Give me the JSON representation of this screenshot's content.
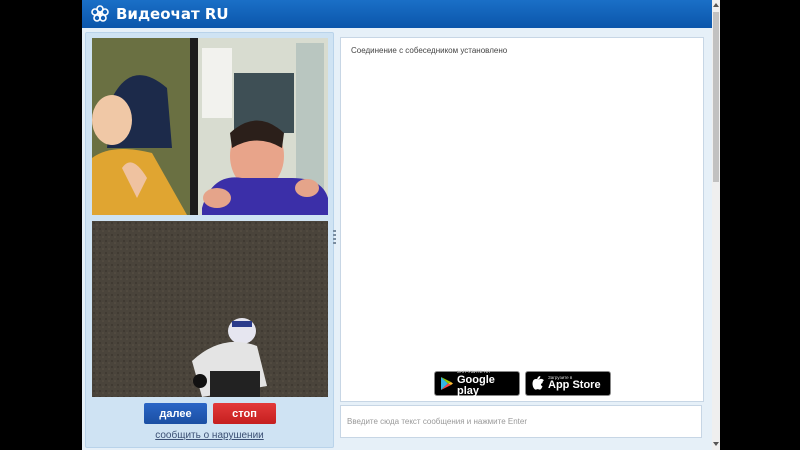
{
  "app": {
    "logo_icon": "flower-logo-icon",
    "title": "Видеочат RU",
    "brand_color": "#0b56ab"
  },
  "video": {
    "partner_icon": "partner-webcam-feed",
    "self_icon": "self-webcam-feed"
  },
  "controls": {
    "next_label": "далее",
    "stop_label": "стоп",
    "report_label": "сообщить о нарушении",
    "next_color": "#1b4fa3",
    "stop_color": "#c51f1f"
  },
  "chat": {
    "status_message": "Соединение с собеседником установлено",
    "input_placeholder": "Введите сюда текст сообщения и нажмите Enter"
  },
  "badges": {
    "google": {
      "small": "ЗАГРУЗИТЕ НА",
      "big": "Google play",
      "icon": "google-play-icon"
    },
    "apple": {
      "small": "Загрузите в",
      "big": "App Store",
      "icon": "apple-icon"
    }
  }
}
